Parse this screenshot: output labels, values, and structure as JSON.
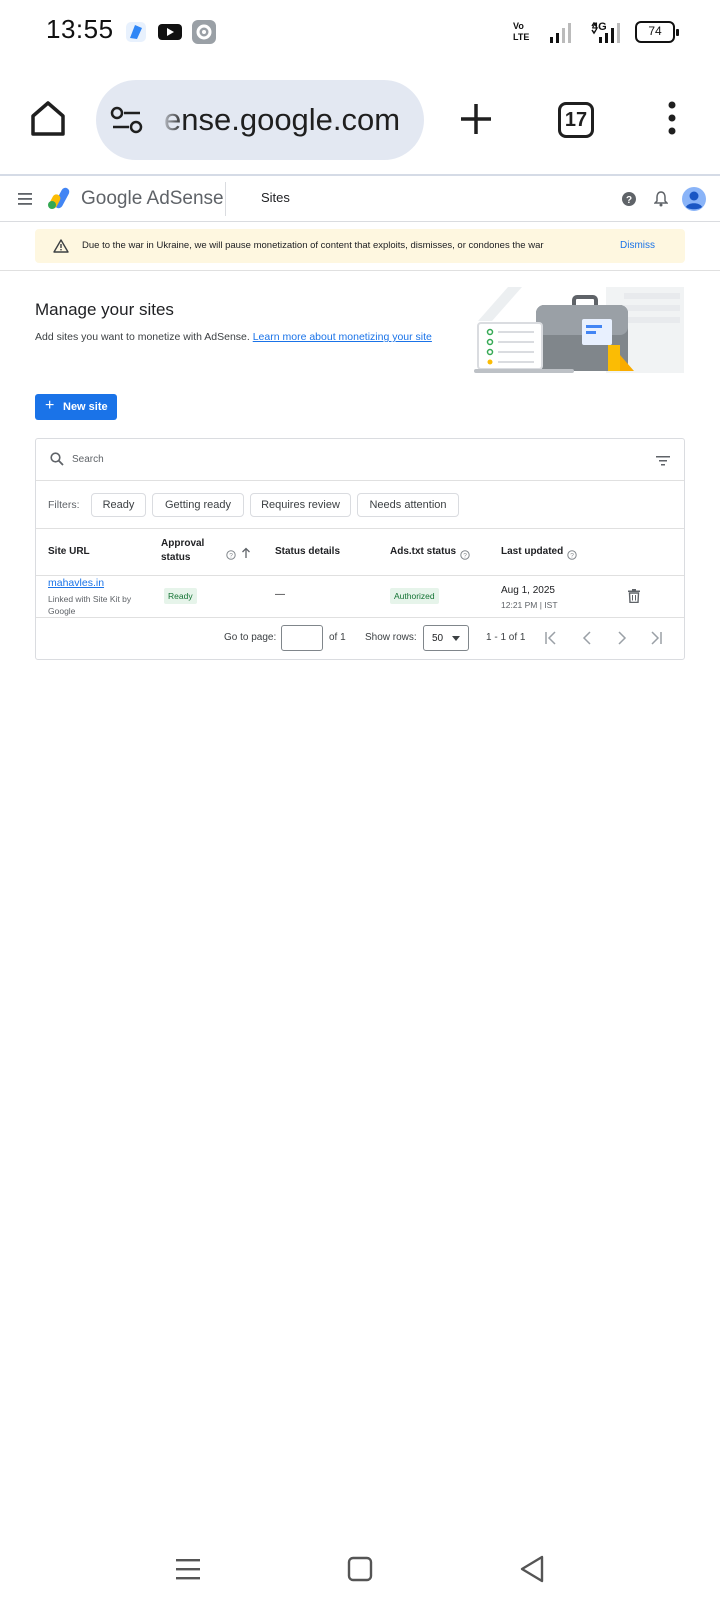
{
  "status_bar": {
    "time": "13:55",
    "network": "4G",
    "volte_line1": "Vo",
    "volte_line2": "LTE",
    "battery": "74"
  },
  "browser": {
    "url": "ense.google.com",
    "tab_count": "17"
  },
  "adsense": {
    "brand_google": "Google",
    "brand_product": "AdSense",
    "section": "Sites"
  },
  "banner": {
    "message": "Due to the war in Ukraine, we will pause monetization of content that exploits, dismisses, or condones the war",
    "dismiss": "Dismiss"
  },
  "manage": {
    "title": "Manage your sites",
    "description": "Add sites you want to monetize with AdSense.",
    "learn_more": "Learn more about monetizing your site",
    "new_site": "New site"
  },
  "table": {
    "search_placeholder": "Search",
    "filters_label": "Filters:",
    "filters": [
      "Ready",
      "Getting ready",
      "Requires review",
      "Needs attention"
    ],
    "columns": {
      "site_url": "Site URL",
      "approval_line1": "Approval",
      "approval_line2": "status",
      "status_details": "Status details",
      "ads_txt": "Ads.txt status",
      "last_updated": "Last updated"
    },
    "rows": [
      {
        "url": "mahavles.in",
        "sub": "Linked with Site Kit by Google",
        "approval": "Ready",
        "details": "—",
        "ads_txt": "Authorized",
        "date": "Aug 1, 2025",
        "time": "12:21 PM | IST"
      }
    ],
    "pagination": {
      "goto_label": "Go to page:",
      "of_pages": "of 1",
      "show_rows_label": "Show rows:",
      "rows_value": "50",
      "range": "1 - 1 of 1"
    }
  },
  "colors": {
    "accent": "#1a73e8",
    "banner_bg": "#fef7e0",
    "success_bg": "#e6f4ea",
    "success_text": "#137333",
    "omnibox_bg": "#e3e8f2"
  }
}
